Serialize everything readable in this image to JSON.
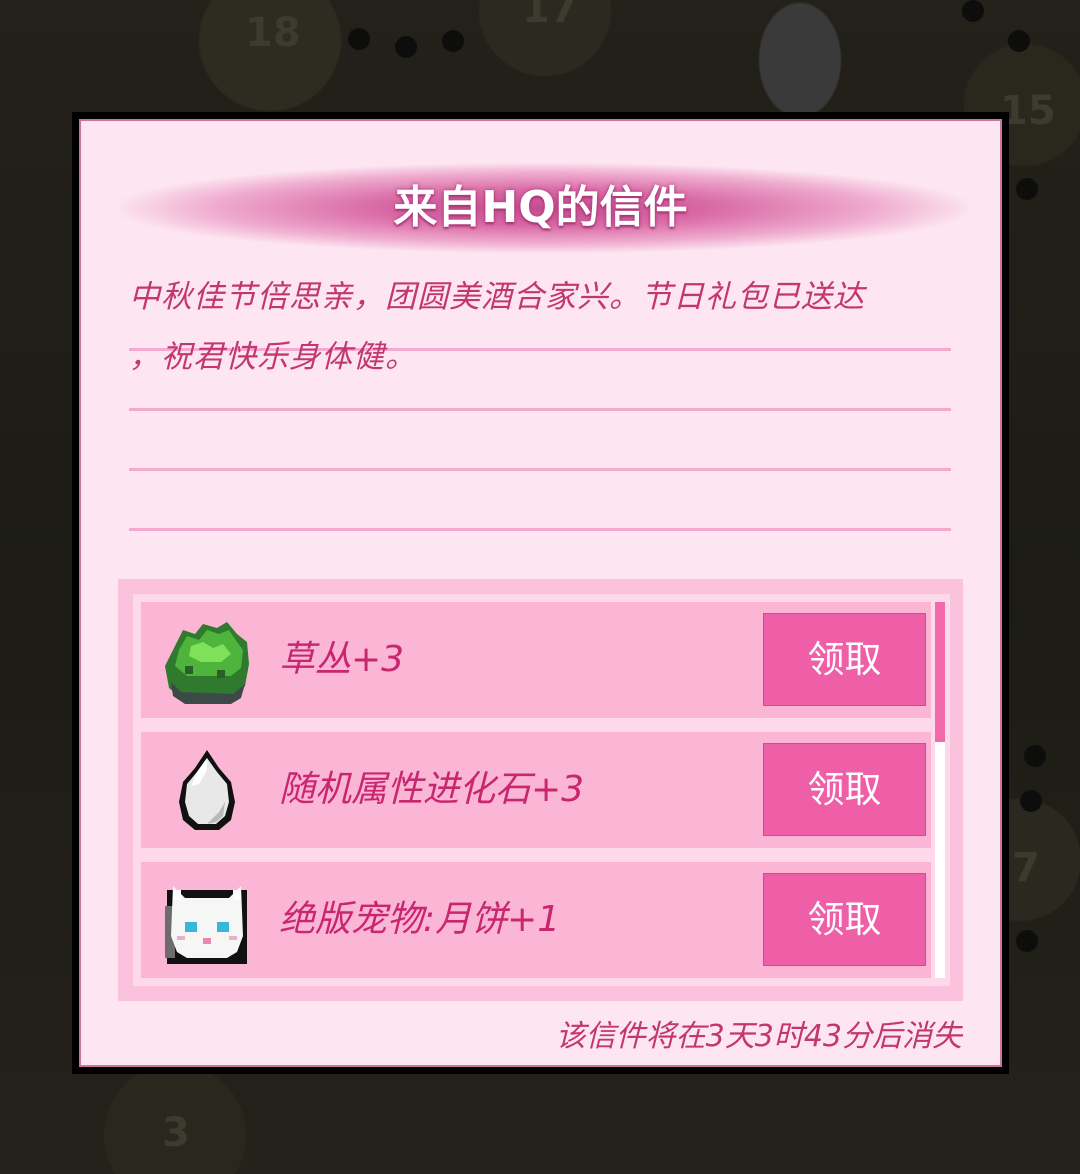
{
  "background": {
    "map_numbers": [
      "18",
      "17",
      "15",
      "7",
      "3"
    ]
  },
  "letter": {
    "title": "来自HQ的信件",
    "message_lines": [
      "中秋佳节倍思亲，团圆美酒合家兴。节日礼包已送达",
      "，祝君快乐身体健。"
    ],
    "expire_text": "该信件将在3天3时43分后消失"
  },
  "rewards": [
    {
      "icon": "grass-bush-icon",
      "name": "草丛+3",
      "claim_label": "领取"
    },
    {
      "icon": "evolution-stone-icon",
      "name": "随机属性进化石+3",
      "claim_label": "领取"
    },
    {
      "icon": "white-cat-pet-icon",
      "name": "绝版宠物:月饼+1",
      "claim_label": "领取"
    }
  ],
  "colors": {
    "panel_bg": "#fde6f1",
    "accent": "#ee5fa8",
    "text": "#c8266f",
    "row_bg": "#fbb6d6"
  }
}
